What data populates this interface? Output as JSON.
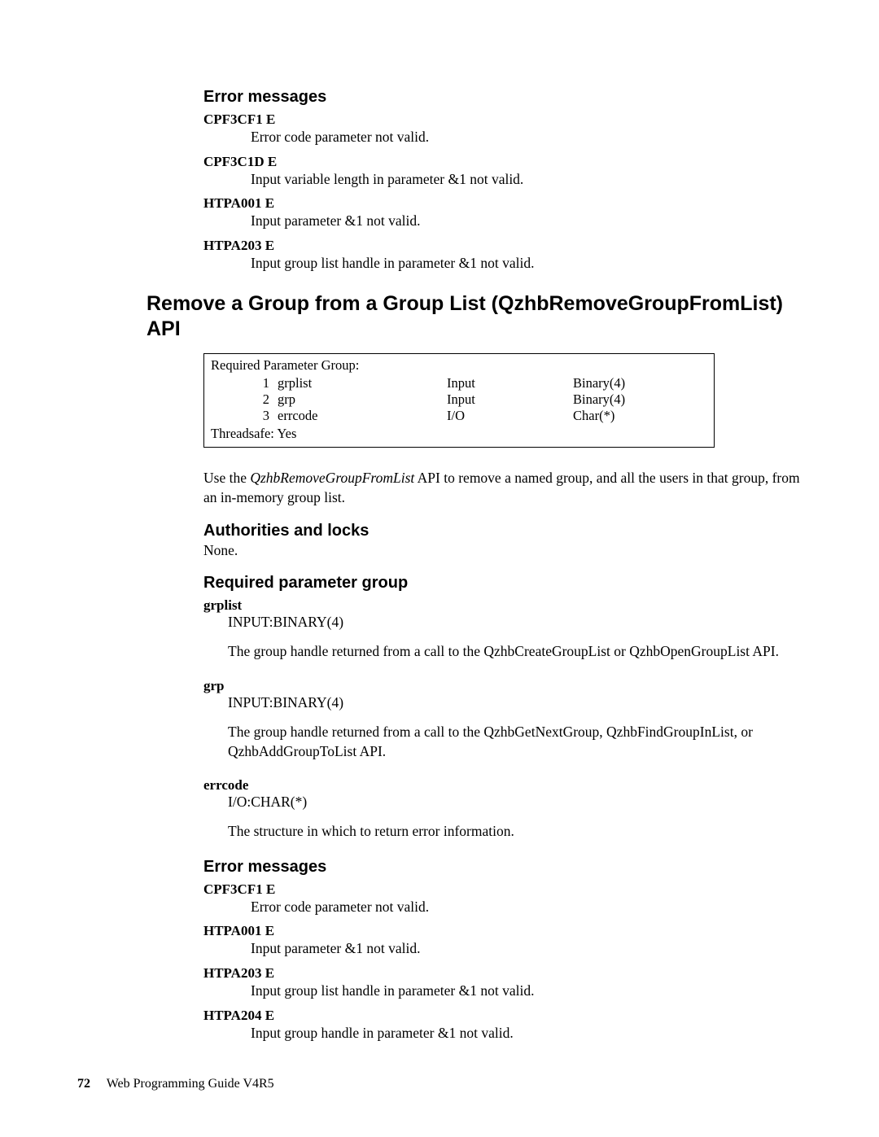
{
  "sections": {
    "error_messages_1": {
      "heading": "Error messages",
      "items": [
        {
          "code": "CPF3CF1 E",
          "desc": "Error code parameter not valid."
        },
        {
          "code": "CPF3C1D E",
          "desc": "Input variable length in parameter &1 not valid."
        },
        {
          "code": "HTPA001 E",
          "desc": "Input parameter &1 not valid."
        },
        {
          "code": "HTPA203 E",
          "desc": "Input group list handle in parameter &1 not valid."
        }
      ]
    },
    "api_title": "Remove a Group from a Group List (QzhbRemoveGroupFromList) API",
    "param_box": {
      "title": "Required Parameter Group:",
      "rows": [
        {
          "num": "1",
          "name": "grplist",
          "io": "Input",
          "type": "Binary(4)"
        },
        {
          "num": "2",
          "name": "grp",
          "io": "Input",
          "type": "Binary(4)"
        },
        {
          "num": "3",
          "name": "errcode",
          "io": "I/O",
          "type": "Char(*)"
        }
      ],
      "threadsafe": "Threadsafe: Yes"
    },
    "intro": {
      "pre": "Use the ",
      "italic": "QzhbRemoveGroupFromList",
      "post": " API to remove a named group, and all the users in that group, from an in-memory group list."
    },
    "authorities": {
      "heading": "Authorities and locks",
      "body": "None."
    },
    "required_params": {
      "heading": "Required parameter group",
      "items": [
        {
          "name": "grplist",
          "type": "INPUT:BINARY(4)",
          "desc": "The group handle returned from a call to the QzhbCreateGroupList or QzhbOpenGroupList API."
        },
        {
          "name": "grp",
          "type": "INPUT:BINARY(4)",
          "desc": "The group handle returned from a call to the QzhbGetNextGroup, QzhbFindGroupInList, or QzhbAddGroupToList API."
        },
        {
          "name": "errcode",
          "type": "I/O:CHAR(*)",
          "desc": "The structure in which to return error information."
        }
      ]
    },
    "error_messages_2": {
      "heading": "Error messages",
      "items": [
        {
          "code": "CPF3CF1 E",
          "desc": "Error code parameter not valid."
        },
        {
          "code": "HTPA001 E",
          "desc": "Input parameter &1 not valid."
        },
        {
          "code": "HTPA203 E",
          "desc": "Input group list handle in parameter &1 not valid."
        },
        {
          "code": "HTPA204 E",
          "desc": "Input group handle in parameter &1 not valid."
        }
      ]
    }
  },
  "footer": {
    "page": "72",
    "title": "Web Programming Guide V4R5"
  }
}
